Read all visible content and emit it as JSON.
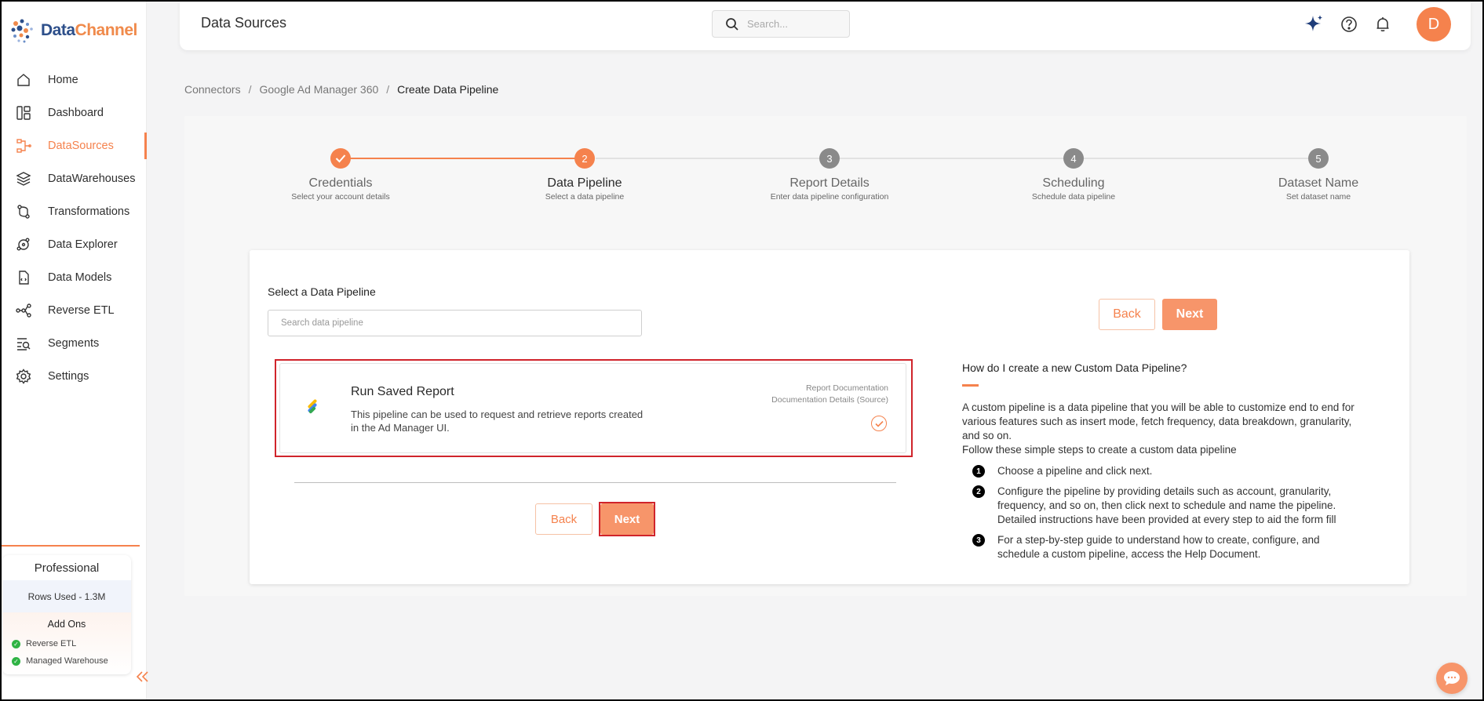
{
  "brand": {
    "name_part1": "Data",
    "name_part2": "Channel"
  },
  "sidebar": {
    "items": [
      {
        "label": "Home",
        "icon": "home-icon"
      },
      {
        "label": "Dashboard",
        "icon": "dashboard-icon"
      },
      {
        "label": "DataSources",
        "icon": "datasources-icon",
        "active": true
      },
      {
        "label": "DataWarehouses",
        "icon": "datawarehouses-icon"
      },
      {
        "label": "Transformations",
        "icon": "transformations-icon"
      },
      {
        "label": "Data Explorer",
        "icon": "data-explorer-icon"
      },
      {
        "label": "Data Models",
        "icon": "data-models-icon"
      },
      {
        "label": "Reverse ETL",
        "icon": "reverse-etl-icon"
      },
      {
        "label": "Segments",
        "icon": "segments-icon"
      },
      {
        "label": "Settings",
        "icon": "settings-icon"
      }
    ],
    "plan": {
      "name": "Professional",
      "rows_used": "Rows Used - 1.3M",
      "addons_title": "Add Ons",
      "addons": [
        "Reverse ETL",
        "Managed Warehouse"
      ]
    }
  },
  "header": {
    "title": "Data Sources",
    "search_placeholder": "Search...",
    "avatar_initial": "D"
  },
  "breadcrumb": {
    "items": [
      "Connectors",
      "Google Ad Manager 360"
    ],
    "current": "Create Data Pipeline",
    "separator": "/"
  },
  "stepper": {
    "steps": [
      {
        "number": "1",
        "title": "Credentials",
        "subtitle": "Select your account details",
        "state": "done"
      },
      {
        "number": "2",
        "title": "Data Pipeline",
        "subtitle": "Select a data pipeline",
        "state": "current"
      },
      {
        "number": "3",
        "title": "Report Details",
        "subtitle": "Enter data pipeline configuration",
        "state": "todo"
      },
      {
        "number": "4",
        "title": "Scheduling",
        "subtitle": "Schedule data pipeline",
        "state": "todo"
      },
      {
        "number": "5",
        "title": "Dataset Name",
        "subtitle": "Set dataset name",
        "state": "todo"
      }
    ]
  },
  "pipeline": {
    "select_label": "Select a Data Pipeline",
    "search_placeholder": "Search data pipeline",
    "item": {
      "title": "Run Saved Report",
      "description": "This pipeline can be used to request and retrieve reports created in the Ad Manager UI.",
      "link_report_docs": "Report Documentation",
      "link_docs_details": "Documentation Details (Source)",
      "selected": true
    }
  },
  "buttons": {
    "back": "Back",
    "next": "Next"
  },
  "help": {
    "title": "How do I create a new Custom Data Pipeline?",
    "intro": "A custom pipeline is a data pipeline that you will be able to customize end to end for various features such as insert mode, fetch frequency, data breakdown, granularity, and so on.",
    "intro2": "Follow these simple steps to create a custom data pipeline",
    "steps": [
      {
        "num": "1",
        "text": "Choose a pipeline and click next."
      },
      {
        "num": "2",
        "text": "Configure the pipeline by providing details such as account, granularity, frequency, and so on, then click next to schedule and name the pipeline. Detailed instructions have been provided at every step to aid the form fill"
      },
      {
        "num": "3",
        "text": "For a step-by-step guide to understand how to create, configure, and schedule a custom pipeline, access the Help Document."
      }
    ]
  },
  "colors": {
    "accent": "#f5824d",
    "next_button": "#f7956a",
    "highlight": "#d0242b",
    "brand_blue": "#2d4f8a"
  }
}
